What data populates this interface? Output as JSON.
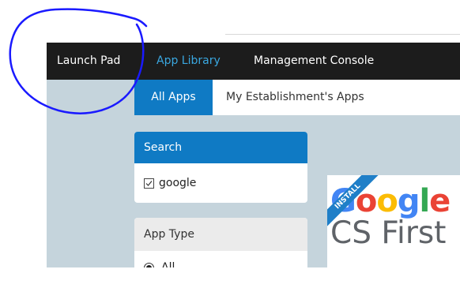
{
  "nav": {
    "items": [
      {
        "label": "Launch Pad"
      },
      {
        "label": "App Library"
      },
      {
        "label": "Management Console"
      }
    ]
  },
  "tabs": {
    "all_apps": "All Apps",
    "my_establishment": "My Establishment's Apps"
  },
  "search": {
    "header": "Search",
    "term": "google",
    "checked": true
  },
  "app_type": {
    "header": "App Type",
    "selected_option": "All"
  },
  "card": {
    "ribbon": "INSTALL",
    "logo_text": "Google",
    "subtitle_text": "CS First"
  },
  "colors": {
    "nav_bg": "#1c1c1c",
    "active_link": "#3aa7e0",
    "accent_blue": "#0f7ac4",
    "content_bg": "#c5d4dc",
    "annotation": "#1a1aff"
  },
  "icons": {
    "checkbox": "checkbox-checked-icon",
    "radio": "radio-selected-icon"
  }
}
